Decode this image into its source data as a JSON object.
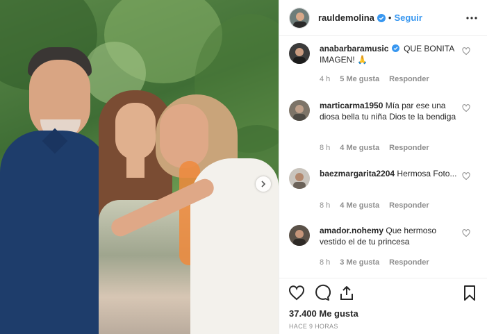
{
  "post": {
    "username": "rauldemolina",
    "separator": "•",
    "follow_label": "Seguir",
    "likes_text": "37.400 Me gusta",
    "time_ago": "HACE 9 HORAS"
  },
  "comments": [
    {
      "username": "anabarbaramusic",
      "verified": true,
      "text": "QUE BONITA IMAGEN! 🙏",
      "time": "4 h",
      "likes": "5 Me gusta",
      "reply": "Responder"
    },
    {
      "username": "marticarma1950",
      "verified": false,
      "text": "Mía par ese una diosa bella tu niña Dios te la bendiga",
      "time": "8 h",
      "likes": "4 Me gusta",
      "reply": "Responder"
    },
    {
      "username": "baezmargarita2204",
      "verified": false,
      "text": "Hermosa Foto...",
      "time": "8 h",
      "likes": "4 Me gusta",
      "reply": "Responder"
    },
    {
      "username": "amador.nohemy",
      "verified": false,
      "text": "Que hermoso vestido el de tu princesa",
      "time": "8 h",
      "likes": "3 Me gusta",
      "reply": "Responder"
    }
  ],
  "colors": {
    "link_blue": "#3897f0",
    "verified_blue": "#3897f0",
    "muted_gray": "#8e8e8e",
    "text": "#262626"
  },
  "icons": {
    "verified": "verified-badge-icon",
    "more": "more-options-icon",
    "comment_like": "heart-outline-icon",
    "like": "heart-outline-icon",
    "comment": "speech-bubble-icon",
    "share": "share-icon",
    "save": "bookmark-icon",
    "next": "chevron-right-icon"
  }
}
